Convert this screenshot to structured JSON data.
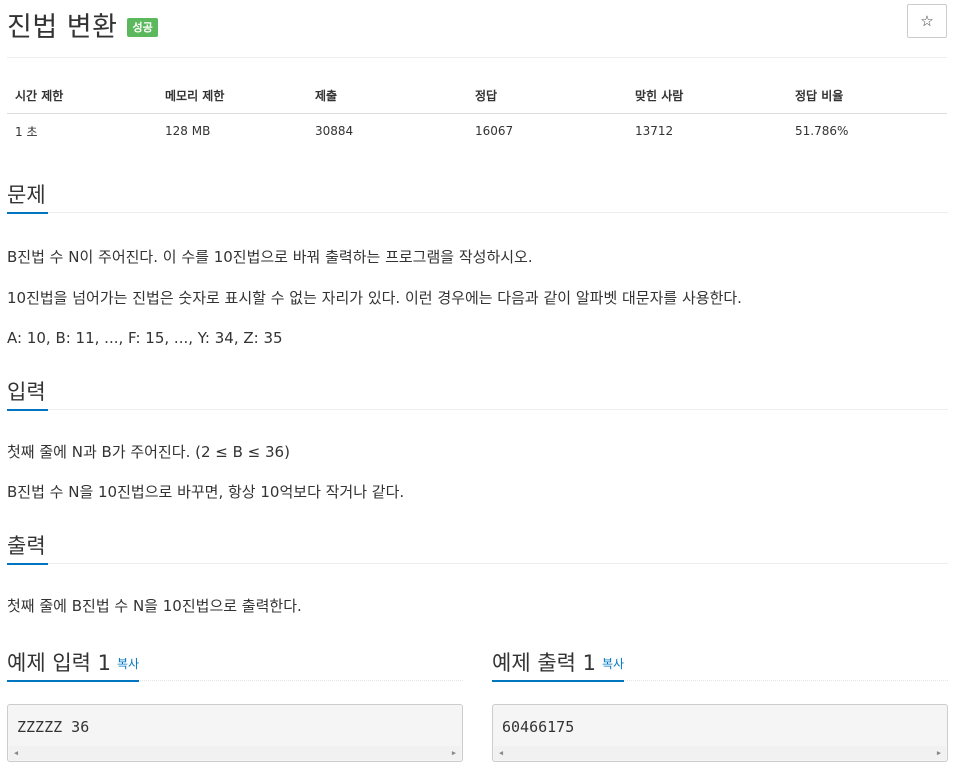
{
  "header": {
    "title": "진법 변환",
    "badge": "성공",
    "star": "☆"
  },
  "info_table": {
    "headers": [
      "시간 제한",
      "메모리 제한",
      "제출",
      "정답",
      "맞힌 사람",
      "정답 비율"
    ],
    "values": [
      "1 초",
      "128 MB",
      "30884",
      "16067",
      "13712",
      "51.786%"
    ]
  },
  "problem": {
    "heading": "문제",
    "paragraphs": [
      "B진법 수 N이 주어진다. 이 수를 10진법으로 바꿔 출력하는 프로그램을 작성하시오.",
      "10진법을 넘어가는 진법은 숫자로 표시할 수 없는 자리가 있다. 이런 경우에는 다음과 같이 알파벳 대문자를 사용한다.",
      "A: 10, B: 11, ..., F: 15, ..., Y: 34, Z: 35"
    ]
  },
  "input": {
    "heading": "입력",
    "paragraphs": [
      "첫째 줄에 N과 B가 주어진다. (2 ≤ B ≤ 36)",
      "B진법 수 N을 10진법으로 바꾸면, 항상 10억보다 작거나 같다."
    ]
  },
  "output": {
    "heading": "출력",
    "paragraphs": [
      "첫째 줄에 B진법 수 N을 10진법으로 출력한다."
    ]
  },
  "samples": {
    "copy_label": "복사",
    "input_heading": "예제 입력 1",
    "input_value": "ZZZZZ 36",
    "output_heading": "예제 출력 1",
    "output_value": "60466175"
  }
}
